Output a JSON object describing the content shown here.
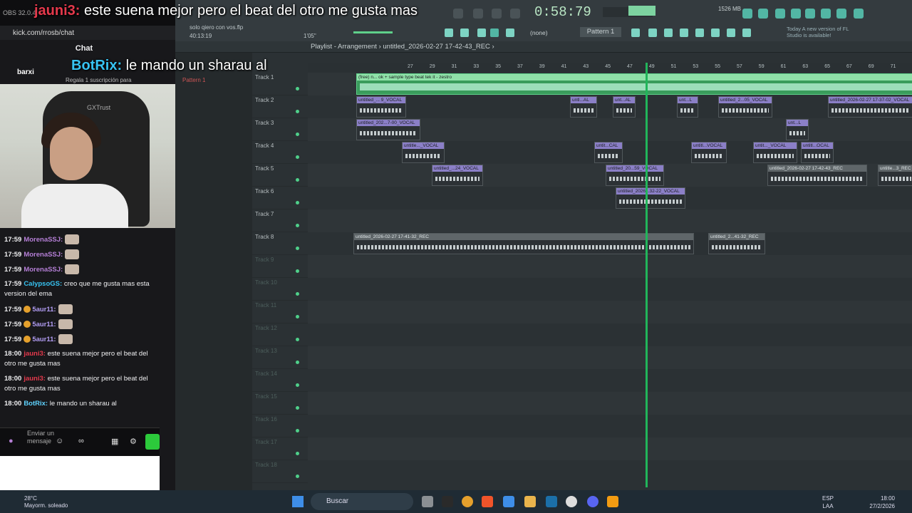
{
  "overlay": {
    "user1": "jauni3:",
    "text1": "este suena mejor pero el beat del otro me gusta mas",
    "user2": "BotRix:",
    "text2": "le mando un sharau al"
  },
  "browser": {
    "title": "OBS 32.0.4",
    "url": "kick.com/rrosb/chat"
  },
  "chat": {
    "title": "Chat",
    "top_user": "barxi",
    "top_note": "Regala 1 suscripción para",
    "messages": [
      {
        "time": "17:59",
        "user": "MorenaSSJ:",
        "text": "",
        "cls": "u1"
      },
      {
        "time": "17:59",
        "user": "MorenaSSJ:",
        "text": "",
        "cls": "u1"
      },
      {
        "time": "17:59",
        "user": "MorenaSSJ:",
        "text": "",
        "cls": "u1"
      },
      {
        "time": "17:59",
        "user": "CalypsoGS:",
        "text": "creo que me gusta mas esta version del ema",
        "cls": "u2"
      },
      {
        "time": "17:59",
        "user": "5aur11:",
        "text": "",
        "cls": "u3"
      },
      {
        "time": "17:59",
        "user": "5aur11:",
        "text": "",
        "cls": "u3"
      },
      {
        "time": "17:59",
        "user": "5aur11:",
        "text": "",
        "cls": "u3"
      },
      {
        "time": "18:00",
        "user": "jauni3:",
        "text": "este suena mejor pero el beat del otro me gusta mas",
        "cls": "u4"
      },
      {
        "time": "18:00",
        "user": "jauni3:",
        "text": "este suena mejor pero el beat del otro me gusta mas",
        "cls": "u4"
      },
      {
        "time": "18:00",
        "user": "BotRix:",
        "text": "le mando un sharau al",
        "cls": "u5"
      }
    ],
    "input_placeholder": "Enviar un mensaje"
  },
  "fl": {
    "timer": "0:58:79",
    "project_hint": "solo qiero con vos.flp",
    "time_info": "40:13:19",
    "tempo_info": "1'05\"",
    "pattern": "Pattern 1",
    "snap": "(none)",
    "update_notice": "Today  A new version of FL Studio is available!",
    "memory": "1526 MB",
    "playlist_title": "Playlist - Arrangement",
    "arrangement_name": "untitled_2026-02-27 17-42-43_REC",
    "sidebar_pattern": "Pattern 1",
    "ruler": [
      "27",
      "29",
      "31",
      "33",
      "35",
      "37",
      "39",
      "41",
      "43",
      "45",
      "47",
      "49",
      "51",
      "53",
      "55",
      "57",
      "59",
      "61",
      "63",
      "65",
      "67",
      "69",
      "71",
      "73",
      "75"
    ],
    "tracks": [
      "Track 1",
      "Track 2",
      "Track 3",
      "Track 4",
      "Track 5",
      "Track 6",
      "Track 7",
      "Track 8",
      "Track 9",
      "Track 10",
      "Track 11",
      "Track 12",
      "Track 13",
      "Track 14",
      "Track 15",
      "Track 16",
      "Track 17",
      "Track 18"
    ],
    "clips": [
      {
        "track": 0,
        "label": "(free) n... ok + sample type beat tek it - zestro",
        "style": "green"
      },
      {
        "track": 1,
        "label": "untitled_... 9_VOCAL",
        "style": "purple"
      },
      {
        "track": 1,
        "label": "untl...AL",
        "style": "purple"
      },
      {
        "track": 1,
        "label": "unt...AL",
        "style": "purple"
      },
      {
        "track": 1,
        "label": "unt...L",
        "style": "purple"
      },
      {
        "track": 1,
        "label": "untitled_2...05_VOCAL",
        "style": "purple"
      },
      {
        "track": 1,
        "label": "untitled_2026-02-27 17-37-02_VOCAL",
        "style": "purple"
      },
      {
        "track": 2,
        "label": "untitled_202...7-00_VOCAL",
        "style": "purple"
      },
      {
        "track": 2,
        "label": "unt...L",
        "style": "purple"
      },
      {
        "track": 3,
        "label": "untitle..._VOCAL",
        "style": "purple"
      },
      {
        "track": 3,
        "label": "untit...CAL",
        "style": "purple"
      },
      {
        "track": 3,
        "label": "untitl...VOCAL",
        "style": "purple"
      },
      {
        "track": 3,
        "label": "untit..._VOCAL",
        "style": "purple"
      },
      {
        "track": 3,
        "label": "untitl...OCAL",
        "style": "purple"
      },
      {
        "track": 4,
        "label": "untitled_...24_VOCAL",
        "style": "purple"
      },
      {
        "track": 4,
        "label": "untitled_20...59_VOCAL",
        "style": "purple"
      },
      {
        "track": 4,
        "label": "untitled_2026-02-27 17-42-43_REC",
        "style": "gray"
      },
      {
        "track": 4,
        "label": "untitle...3_REC",
        "style": "gray"
      },
      {
        "track": 5,
        "label": "untitled_2026...32-22_VOCAL",
        "style": "purple"
      },
      {
        "track": 7,
        "label": "untitled_2026-02-27 17-41-32_REC",
        "style": "gray"
      },
      {
        "track": 7,
        "label": "untitled_2...41-32_REC",
        "style": "gray"
      }
    ]
  },
  "taskbar": {
    "weather_temp": "28°C",
    "weather_desc": "Mayorm. soleado",
    "search": "Buscar",
    "lang1": "ESP",
    "lang2": "LAA",
    "time": "18:00",
    "date": "27/2/2026"
  }
}
